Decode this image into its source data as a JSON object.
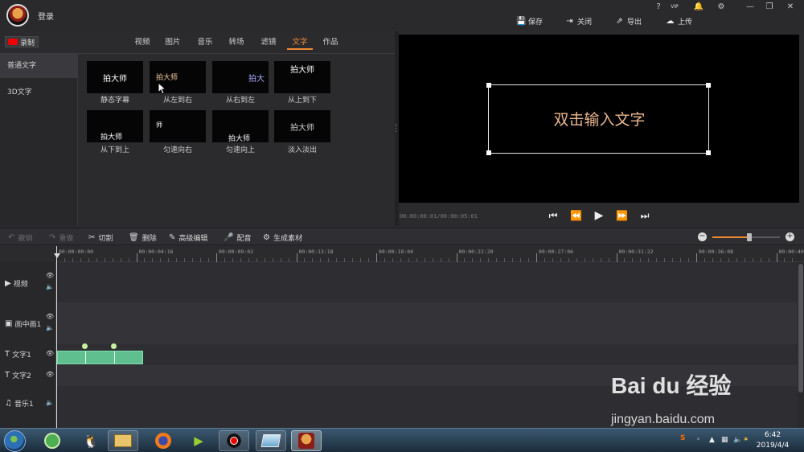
{
  "titlebar": {
    "login": "登录",
    "win_controls": [
      "?",
      "VIP",
      "🔔",
      "⚙",
      "—",
      "❐",
      "✕"
    ],
    "actions": [
      {
        "label": "保存",
        "icon": "save-icon"
      },
      {
        "label": "关闭",
        "icon": "close-project-icon"
      },
      {
        "label": "导出",
        "icon": "export-icon"
      },
      {
        "label": "上传",
        "icon": "upload-icon"
      }
    ]
  },
  "record_button": "录制",
  "tabs": [
    "视频",
    "图片",
    "音乐",
    "转场",
    "滤镜",
    "文字",
    "作品"
  ],
  "active_tab": "文字",
  "sidebar": [
    "普通文字",
    "3D文字"
  ],
  "text_effects": [
    {
      "label": "静态字幕",
      "preview": "拍大师"
    },
    {
      "label": "从左到右",
      "preview": "拍大师"
    },
    {
      "label": "从右到左",
      "preview": "拍大"
    },
    {
      "label": "从上到下",
      "preview": "拍大师"
    },
    {
      "label": "从下到上",
      "preview": "拍大师"
    },
    {
      "label": "匀速向右",
      "preview": "师"
    },
    {
      "label": "匀速向上",
      "preview": "拍大师"
    },
    {
      "label": "淡入淡出",
      "preview": "拍大师"
    }
  ],
  "preview": {
    "overlay_text": "双击输入文字",
    "timecode": "00:00:00:01/00:00:05:01"
  },
  "toolbar": [
    {
      "label": "撤销",
      "icon": "undo-icon",
      "enabled": false
    },
    {
      "label": "重做",
      "icon": "redo-icon",
      "enabled": false
    },
    {
      "label": "切割",
      "icon": "scissors-icon",
      "enabled": true
    },
    {
      "label": "删除",
      "icon": "trash-icon",
      "enabled": true
    },
    {
      "label": "高级编辑",
      "icon": "pencil-icon",
      "enabled": true
    },
    {
      "label": "配音",
      "icon": "microphone-icon",
      "enabled": true
    },
    {
      "label": "生成素材",
      "icon": "gear-icon",
      "enabled": true
    }
  ],
  "zoom": {
    "level": 0.55
  },
  "ruler": [
    "00:00:00:00",
    "00:00:04:16",
    "00:00:09:02",
    "00:00:13:18",
    "00:00:18:04",
    "00:00:22:20",
    "00:00:27:06",
    "00:00:31:22",
    "00:00:36:08",
    "00:00:40:"
  ],
  "tracks": [
    {
      "label": "视频",
      "icon": "▶"
    },
    {
      "label": "画中画1",
      "icon": "▣"
    },
    {
      "label": "文字1",
      "icon": "T"
    },
    {
      "label": "文字2",
      "icon": "T"
    },
    {
      "label": "音乐1",
      "icon": "♫"
    }
  ],
  "taskbar": {
    "time": "6:42",
    "date": "2019/4/4"
  },
  "watermark": {
    "brand": "Bai du 经验",
    "url": "jingyan.baidu.com"
  }
}
